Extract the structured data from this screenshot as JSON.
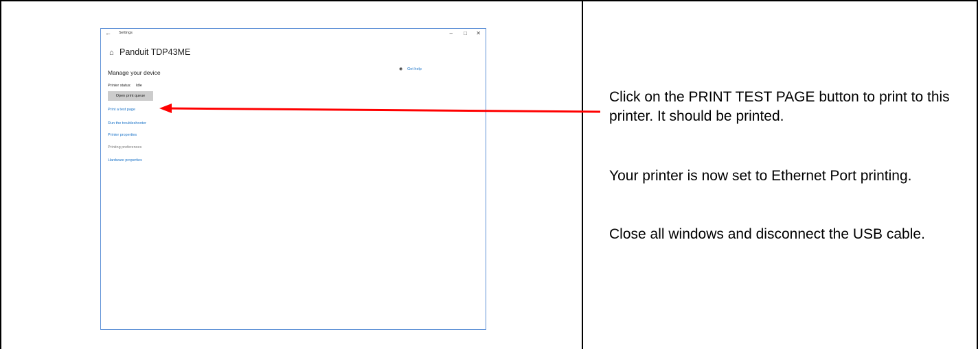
{
  "settings_window": {
    "title": "Settings",
    "back_icon": "back-arrow-icon",
    "home_icon": "home-icon",
    "help_icon": "chat-help-icon",
    "printer_name": "Panduit TDP43ME",
    "section_title": "Manage your device",
    "get_help": "Get help",
    "status_label": "Printer status:",
    "status_value": "Idle",
    "open_queue_button": "Open print queue",
    "links": [
      "Print a test page",
      "Run the troubleshooter",
      "Printer properties",
      "Printing preferences",
      "Hardware properties"
    ],
    "accent_color": "#1a73c8"
  },
  "instructions": {
    "paragraph_1": "Click on the PRINT TEST PAGE button to print to this printer.  It should be printed.",
    "paragraph_2": "Your printer is now set to Ethernet Port printing.",
    "paragraph_3": "Close all windows and disconnect the USB cable."
  },
  "arrow_color": "#ff0000"
}
